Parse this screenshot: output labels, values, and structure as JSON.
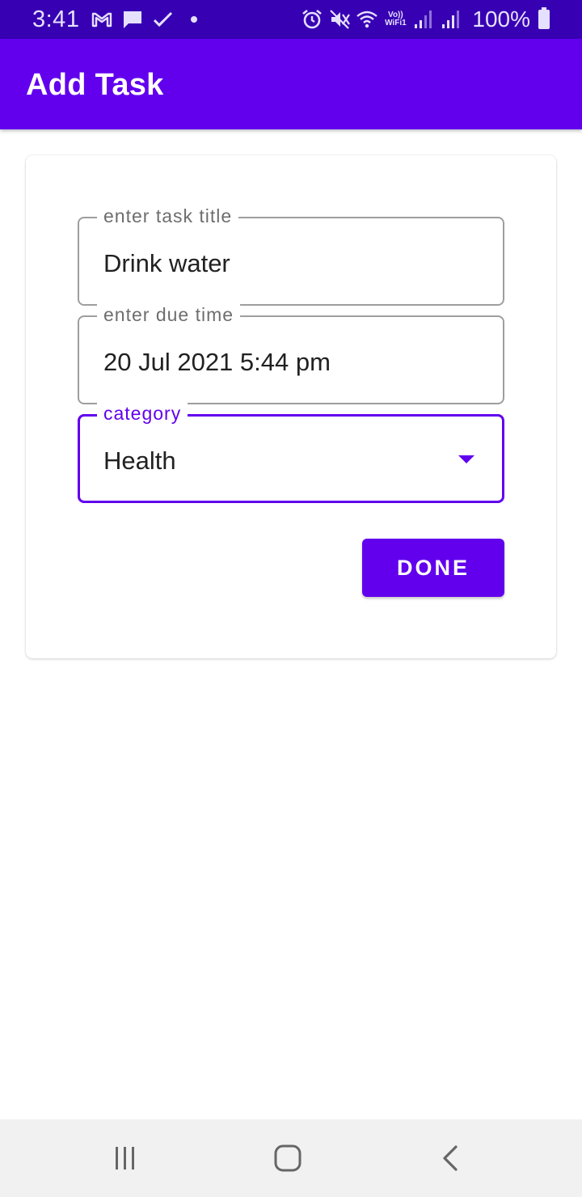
{
  "status_bar": {
    "time": "3:41",
    "left_icons": [
      "gmail-icon",
      "message-icon",
      "check-icon",
      "dot-icon"
    ],
    "right_icons": [
      "alarm-icon",
      "mute-icon",
      "wifi-icon",
      "vowifi-icon",
      "signal-icon",
      "signal-icon",
      "battery-icon"
    ],
    "vowifi_line1": "Vo))",
    "vowifi_line2": "WiFi1",
    "battery_percent": "100%"
  },
  "app_bar": {
    "title": "Add Task"
  },
  "form": {
    "title_field": {
      "label": "enter task title",
      "value": "Drink water"
    },
    "due_field": {
      "label": "enter due time",
      "value": "20 Jul 2021 5:44 pm"
    },
    "category_field": {
      "label": "category",
      "value": "Health",
      "icon": "dropdown-arrow-icon"
    },
    "done_label": "DONE"
  },
  "nav_bar": {
    "buttons": [
      "recents-icon",
      "home-icon",
      "back-icon"
    ]
  },
  "colors": {
    "status_bar": "#3700b3",
    "primary": "#6200ee",
    "field_border": "#9e9e9e",
    "nav_bar": "#f1f1f1"
  }
}
